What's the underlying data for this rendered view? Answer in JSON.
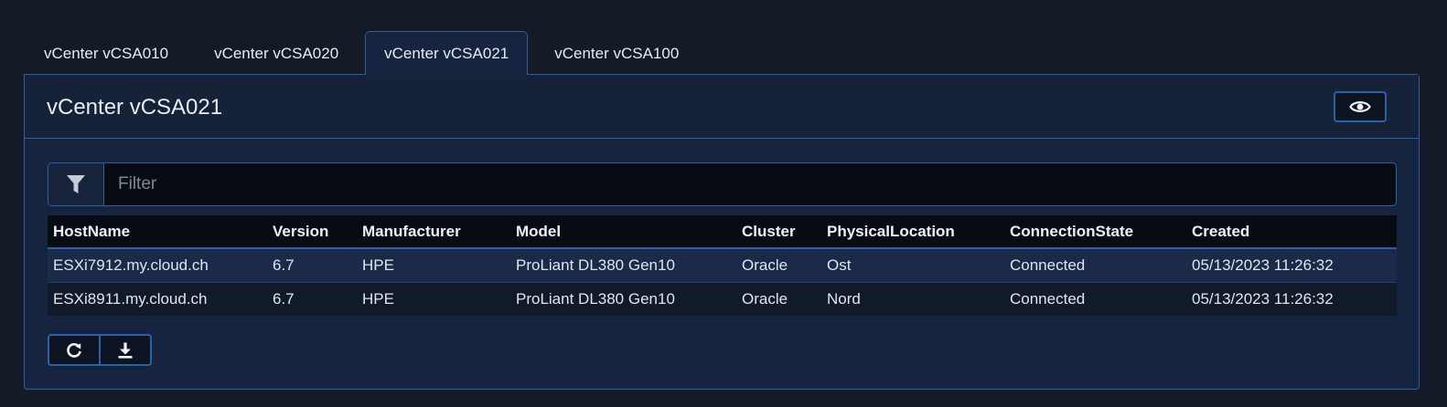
{
  "tabs": [
    {
      "label": "vCenter vCSA010",
      "active": false
    },
    {
      "label": "vCenter vCSA020",
      "active": false
    },
    {
      "label": "vCenter vCSA021",
      "active": true
    },
    {
      "label": "vCenter vCSA100",
      "active": false
    }
  ],
  "panel": {
    "title": "vCenter vCSA021",
    "toggle_icon": "eye-icon"
  },
  "filter": {
    "icon": "filter-icon",
    "placeholder": "Filter",
    "value": ""
  },
  "table": {
    "columns": [
      "HostName",
      "Version",
      "Manufacturer",
      "Model",
      "Cluster",
      "PhysicalLocation",
      "ConnectionState",
      "Created"
    ],
    "rows": [
      [
        "ESXi7912.my.cloud.ch",
        "6.7",
        "HPE",
        "ProLiant DL380 Gen10",
        "Oracle",
        "Ost",
        "Connected",
        "05/13/2023 11:26:32"
      ],
      [
        "ESXi8911.my.cloud.ch",
        "6.7",
        "HPE",
        "ProLiant DL380 Gen10",
        "Oracle",
        "Nord",
        "Connected",
        "05/13/2023 11:26:32"
      ]
    ]
  },
  "actions": {
    "refresh_icon": "refresh-icon",
    "download_icon": "download-icon"
  },
  "colors": {
    "background": "#141b26",
    "panel": "#172440",
    "accent_border": "#2c5fa8",
    "table_header": "#070b12"
  }
}
